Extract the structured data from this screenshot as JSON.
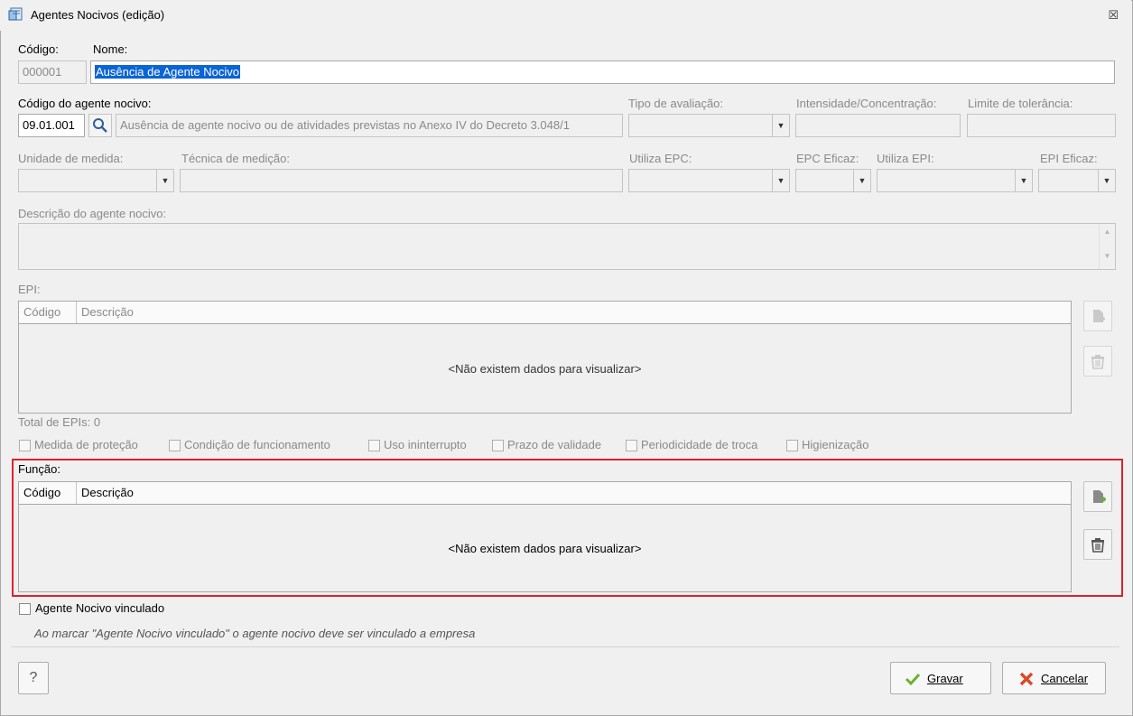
{
  "window": {
    "title": "Agentes Nocivos (edição)",
    "close_glyph": "☒"
  },
  "codigo": {
    "label": "Código:",
    "value": "000001"
  },
  "nome": {
    "label": "Nome:",
    "value": "Ausência de Agente Nocivo"
  },
  "agente": {
    "label": "Código do agente nocivo:",
    "code": "09.01.001",
    "description": "Ausência de agente nocivo ou de atividades previstas no Anexo IV do Decreto 3.048/1"
  },
  "tipo_avaliacao": {
    "label": "Tipo de avaliação:"
  },
  "intensidade": {
    "label": "Intensidade/Concentração:"
  },
  "limite": {
    "label": "Limite de tolerância:"
  },
  "unidade": {
    "label": "Unidade de medida:"
  },
  "tecnica": {
    "label": "Técnica de medição:"
  },
  "utiliza_epc": {
    "label": "Utiliza EPC:"
  },
  "epc_eficaz": {
    "label": "EPC Eficaz:"
  },
  "utiliza_epi": {
    "label": "Utiliza EPI:"
  },
  "epi_eficaz": {
    "label": "EPI Eficaz:"
  },
  "descricao": {
    "label": "Descrição do agente nocivo:"
  },
  "epi": {
    "label": "EPI:",
    "columns": [
      "Código",
      "Descrição"
    ],
    "empty": "<Não existem dados para visualizar>",
    "total": "Total de EPIs: 0",
    "checks": [
      "Medida de proteção",
      "Condição de funcionamento",
      "Uso ininterrupto",
      "Prazo de validade",
      "Periodicidade de troca",
      "Higienização"
    ]
  },
  "funcao": {
    "label": "Função:",
    "columns": [
      "Código",
      "Descrição"
    ],
    "empty": "<Não existem dados para visualizar>"
  },
  "vinculado": {
    "label": "Agente Nocivo vinculado",
    "note": "Ao marcar \"Agente Nocivo vinculado\" o agente nocivo deve ser vinculado a empresa"
  },
  "buttons": {
    "help": "?",
    "save": "Gravar",
    "cancel": "Cancelar"
  },
  "colors": {
    "highlight_border": "#d9242b",
    "selection": "#0a64d6",
    "save_icon": "#6ab22e",
    "cancel_icon": "#d9482b"
  }
}
